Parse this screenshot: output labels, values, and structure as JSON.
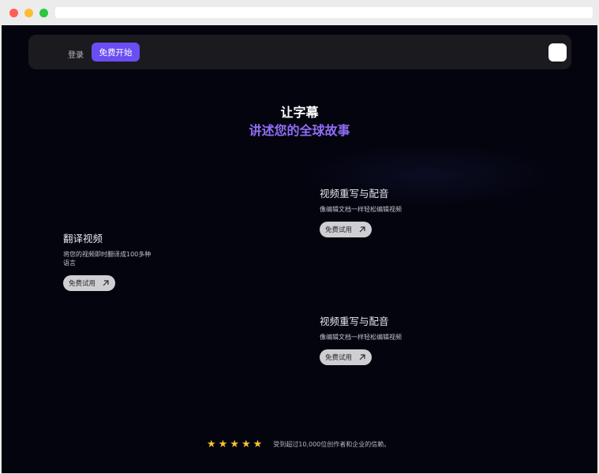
{
  "nav": {
    "login_label": "登录",
    "start_label": "免费开始"
  },
  "hero": {
    "title": "让字幕",
    "subtitle": "讲述您的全球故事"
  },
  "cards": [
    {
      "title": "翻译视频",
      "desc": "将您的视频即时翻译成100多种语言",
      "button_label": "免费试用"
    },
    {
      "title": "视频重写与配音",
      "desc": "像编辑文档一样轻松编辑视频",
      "button_label": "免费试用"
    },
    {
      "title": "视频重写与配音",
      "desc": "像编辑文档一样轻松编辑视频",
      "button_label": "免费试用"
    }
  ],
  "rating": {
    "stars": 5,
    "text": "受到超过10,000位创作者和企业的信赖。"
  },
  "colors": {
    "accent": "#6a4df3",
    "subtitle_gradient": "#8f6df6",
    "background": "#04040f",
    "star": "#f4c430"
  }
}
